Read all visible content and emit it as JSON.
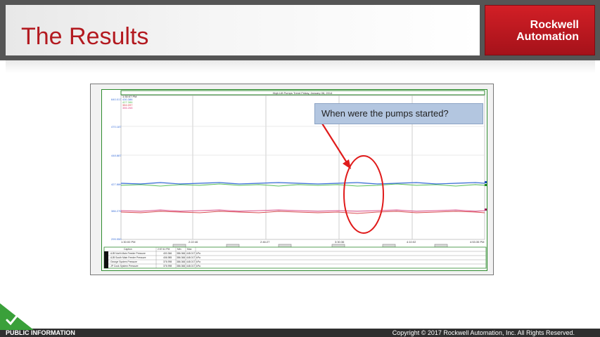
{
  "slide": {
    "title": "The Results",
    "logo": {
      "line1": "Rockwell",
      "line2": "Automation"
    },
    "callout": "When were the pumps started?",
    "footer": {
      "left": "PUBLIC INFORMATION",
      "right": "Copyright © 2017 Rockwell Automation, Inc. All Rights Reserved."
    }
  },
  "trend": {
    "title": "High Lift Pumps Trend     Friday, January 06, 2014",
    "y_tick_labels": [
      "640.017",
      "470.187",
      "448.887",
      "427.886",
      "386.276",
      "299.950"
    ],
    "x_tick_labels": [
      "1:30:00 PM",
      "2:22:46",
      "2:46:27",
      "3:30:36",
      "4:10:02",
      "4:53:35 PM"
    ],
    "legend_values": [
      "1:30:07 PM",
      "430.386",
      "427.386",
      "384.097",
      "386.268"
    ],
    "x_axis_caption": "Time",
    "table_headers": [
      "Caption",
      "2:57:41 PM",
      "Min",
      "Max"
    ],
    "table_rows": [
      [
        "AJB North Main Feeder Pressure",
        "400.366",
        "386.366",
        "448.017",
        "kPa"
      ],
      [
        "AJB South Main Feeder Pressure",
        "406.985",
        "386.366",
        "448.017",
        "kPa"
      ],
      [
        "George System Pressure",
        "376.998",
        "386.366",
        "448.017",
        "kPa"
      ],
      [
        "JP Cook System Pressure",
        "376.998",
        "386.366",
        "448.017",
        "kPa"
      ]
    ],
    "colors": {
      "blue": "#3b6fd8",
      "green": "#58c158",
      "pink": "#e0508c",
      "red": "#d8494e",
      "annotation": "#e01b1b",
      "frame_green": "#2e8b2e",
      "title_red": "#b3191f"
    }
  }
}
